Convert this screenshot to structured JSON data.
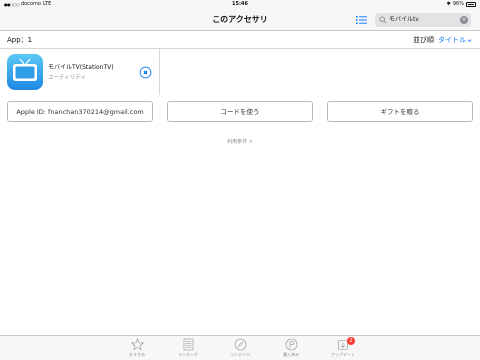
{
  "status_bar": {
    "carrier": "docomo",
    "network": "LTE",
    "time": "15:46",
    "battery": "96%"
  },
  "nav": {
    "title": "このアクセサリ"
  },
  "search": {
    "value": "モバイルtv"
  },
  "subheader": {
    "app_count": "App：1",
    "sort_label": "並び順",
    "sort_value": "タイトル"
  },
  "apps": [
    {
      "name": "モバイルTV(StationTV)",
      "category": "ユーティリティ"
    }
  ],
  "buttons": {
    "apple_id": "Apple ID: fnanchan370214@gmail.com",
    "redeem": "コードを使う",
    "gift": "ギフトを贈る"
  },
  "terms": "利用条件 >",
  "tabbar": {
    "items": [
      {
        "label": "おすすめ",
        "icon": "star-icon"
      },
      {
        "label": "ランキング",
        "icon": "list-icon"
      },
      {
        "label": "コンテンツ",
        "icon": "compass-icon"
      },
      {
        "label": "購入済み",
        "icon": "purchased-icon"
      },
      {
        "label": "アップデート",
        "icon": "updates-icon",
        "badge": "2"
      }
    ]
  },
  "colors": {
    "accent": "#147efb",
    "badge": "#ff3b30"
  }
}
